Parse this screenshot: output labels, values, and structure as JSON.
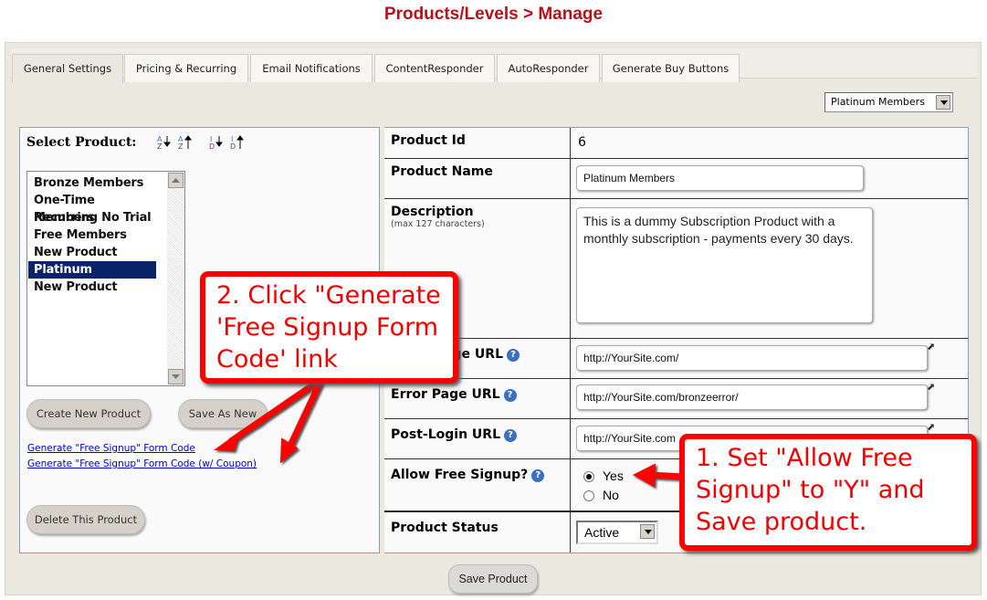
{
  "page": {
    "title": "Products/Levels > Manage"
  },
  "tabs": [
    {
      "label": "General Settings",
      "active": true
    },
    {
      "label": "Pricing & Recurring"
    },
    {
      "label": "Email Notifications"
    },
    {
      "label": "ContentResponder"
    },
    {
      "label": "AutoResponder"
    },
    {
      "label": "Generate Buy Buttons"
    }
  ],
  "product_selector": {
    "selected": "Platinum Members"
  },
  "left_panel": {
    "select_label": "Select Product:",
    "sort_icons": [
      "sort-alpha-asc-icon",
      "sort-alpha-desc-icon",
      "sort-id-asc-icon",
      "sort-id-desc-icon"
    ],
    "products": [
      "Bronze Members",
      "One-Time Members",
      "Recurring No Trial",
      "Free Members",
      "New Product",
      "Platinum Members",
      "New Product"
    ],
    "selected_index": 5,
    "create_button": "Create New Product",
    "save_as_new_button": "Save As New",
    "link_free_signup": "Generate \"Free Signup\" Form Code",
    "link_free_signup_coupon": "Generate \"Free Signup\" Form Code (w/ Coupon)",
    "delete_button": "Delete This Product"
  },
  "form": {
    "product_id_label": "Product Id",
    "product_id": "6",
    "product_name_label": "Product Name",
    "product_name": "Platinum Members",
    "description_label": "Description",
    "description_hint": "(max 127 characters)",
    "description": "This is a dummy Subscription Product with a monthly subscription - payments every 30 days.",
    "login_url_label": "Login Page URL",
    "login_url": "http://YourSite.com/",
    "error_url_label": "Error Page URL",
    "error_url": "http://YourSite.com/bronzeerror/",
    "post_login_label": "Post-Login URL",
    "post_login_url": "http://YourSite.com",
    "allow_free_label": "Allow Free Signup?",
    "allow_free_options": [
      "Yes",
      "No"
    ],
    "allow_free_value": "Yes",
    "status_label": "Product Status",
    "status_value": "Active"
  },
  "save_button": "Save Product",
  "callouts": {
    "step2": "2. Click \"Generate 'Free Signup Form Code' link",
    "step1": "1. Set \"Allow Free Signup\" to \"Y\" and Save product."
  },
  "colors": {
    "title": "#b5121b",
    "callout": "#ff0000",
    "selection": "#0a246a",
    "link": "#0000cc"
  }
}
